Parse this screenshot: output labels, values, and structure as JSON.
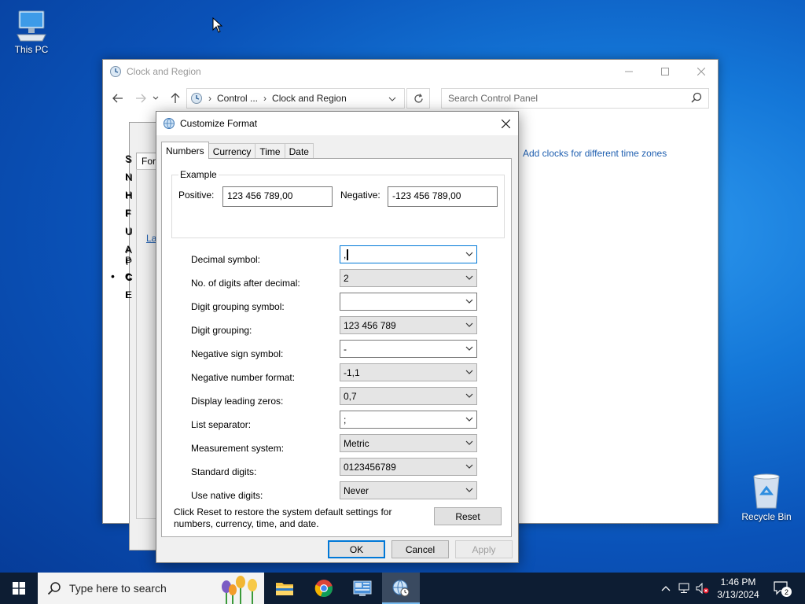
{
  "desktop": {
    "this_pc_label": "This PC",
    "recycle_bin_label": "Recycle Bin"
  },
  "control_panel": {
    "title": "Clock and Region",
    "breadcrumb": [
      "Control ...",
      "Clock and Region"
    ],
    "search_placeholder": "Search Control Panel",
    "link_add_clocks": "Add clocks for different time zones"
  },
  "region_dialog_partial": {
    "tab_partial": "Form",
    "letters": [
      "S",
      "N",
      "H",
      "F",
      "U",
      "A",
      "P",
      "C",
      "E"
    ],
    "link_partial": "La"
  },
  "customize_format": {
    "title": "Customize Format",
    "tabs": [
      "Numbers",
      "Currency",
      "Time",
      "Date"
    ],
    "active_tab": "Numbers",
    "example": {
      "legend": "Example",
      "positive_label": "Positive:",
      "positive_value": "123 456 789,00",
      "negative_label": "Negative:",
      "negative_value": "-123 456 789,00"
    },
    "settings": [
      {
        "label": "Decimal symbol:",
        "value": ",",
        "editable": true,
        "focused": true
      },
      {
        "label": "No. of digits after decimal:",
        "value": "2",
        "editable": false
      },
      {
        "label": "Digit grouping symbol:",
        "value": "",
        "editable": true
      },
      {
        "label": "Digit grouping:",
        "value": "123 456 789",
        "editable": false
      },
      {
        "label": "Negative sign symbol:",
        "value": "-",
        "editable": true
      },
      {
        "label": "Negative number format:",
        "value": "-1,1",
        "editable": false
      },
      {
        "label": "Display leading zeros:",
        "value": "0,7",
        "editable": false
      },
      {
        "label": "List separator:",
        "value": ";",
        "editable": true
      },
      {
        "label": "Measurement system:",
        "value": "Metric",
        "editable": false
      },
      {
        "label": "Standard digits:",
        "value": "0123456789",
        "editable": false
      },
      {
        "label": "Use native digits:",
        "value": "Never",
        "editable": false
      }
    ],
    "reset_text": "Click Reset to restore the system default settings for numbers, currency, time, and date.",
    "reset_button": "Reset",
    "ok_button": "OK",
    "cancel_button": "Cancel",
    "apply_button": "Apply"
  },
  "taskbar": {
    "search_placeholder": "Type here to search",
    "time": "1:46 PM",
    "date": "3/13/2024",
    "notification_count": "2"
  },
  "colors": {
    "accent": "#0078d7",
    "link": "#1f5fb0",
    "taskbar": "#0d1d33"
  }
}
